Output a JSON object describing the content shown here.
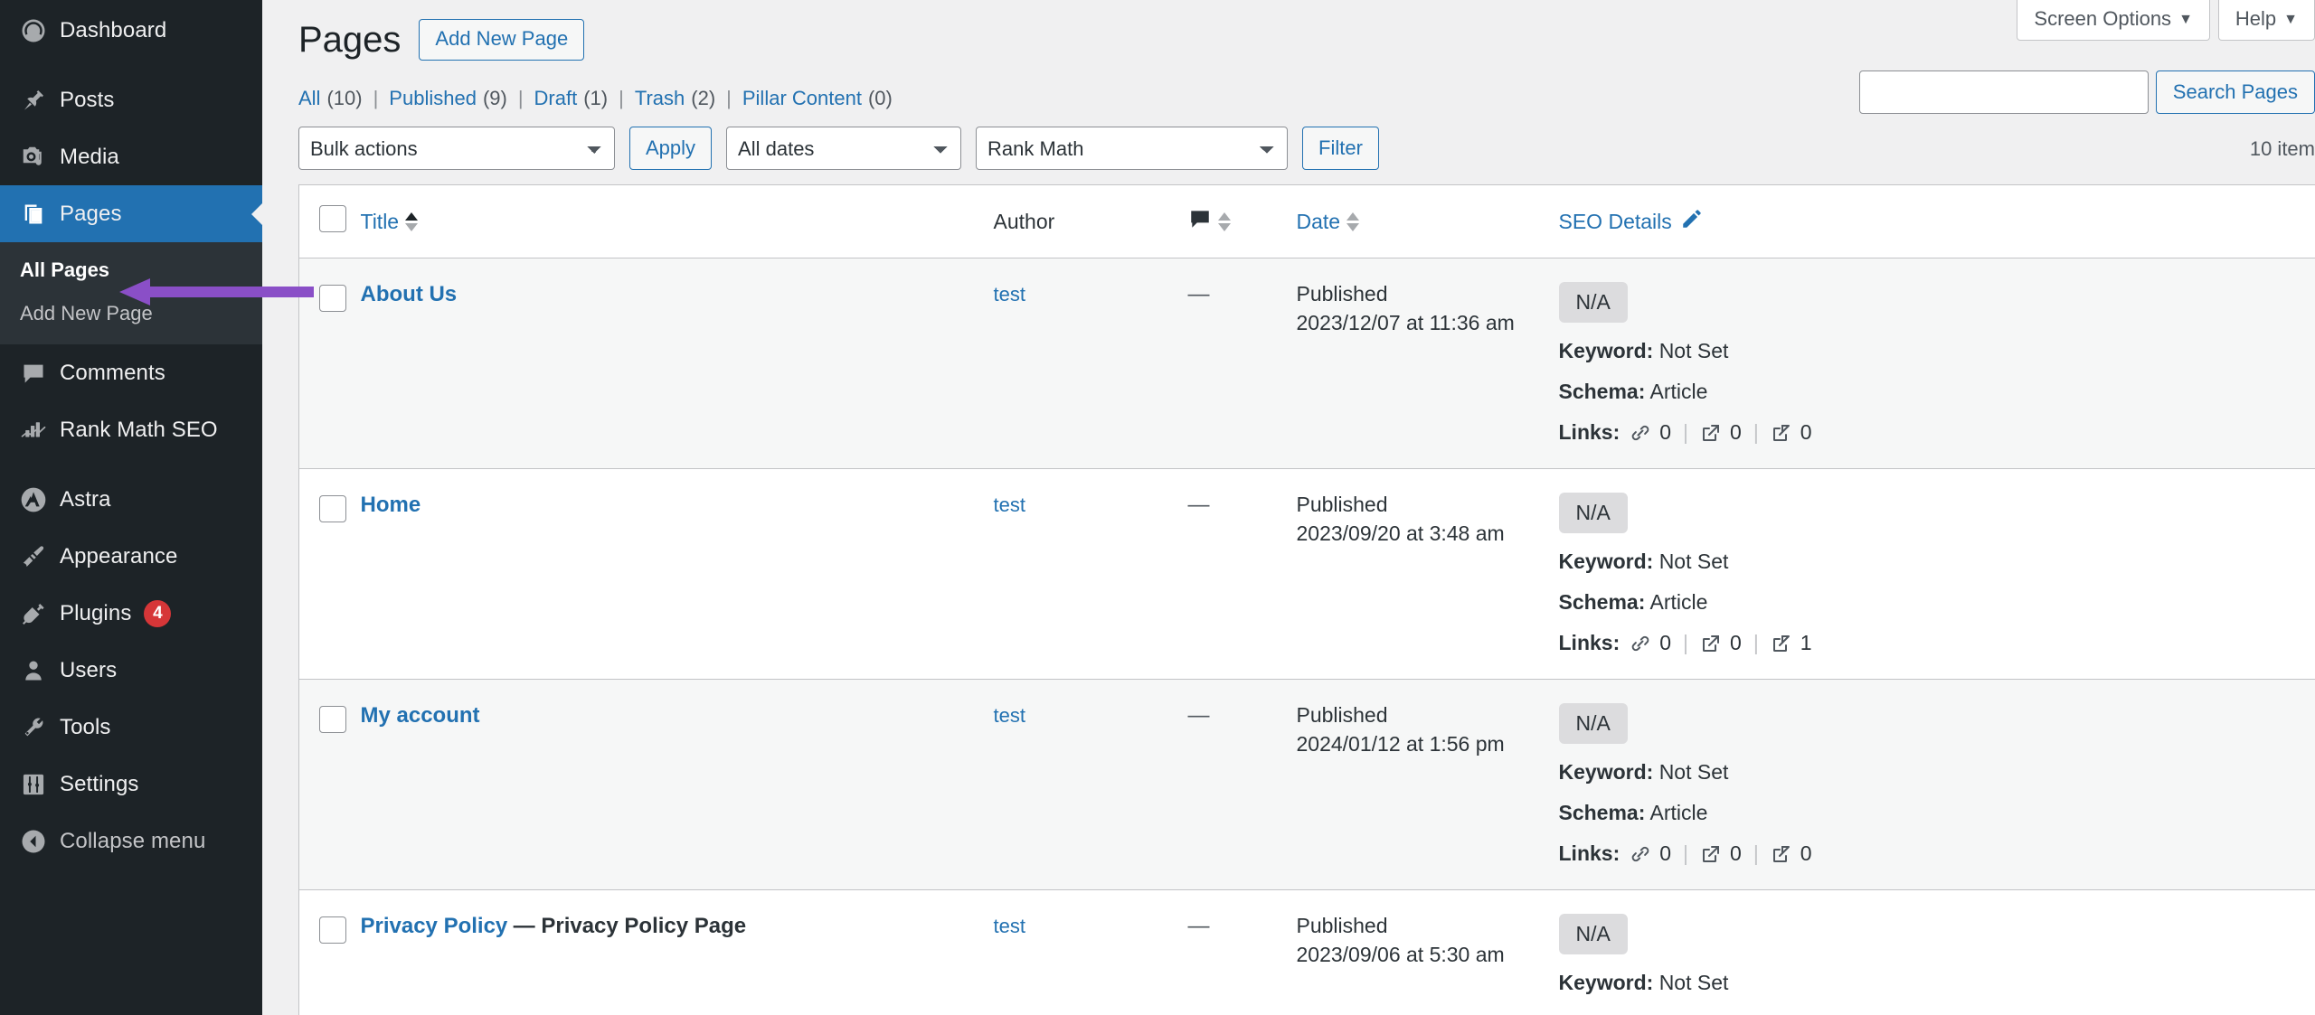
{
  "sidebar": {
    "items": [
      {
        "label": "Dashboard",
        "icon": "dashboard-icon",
        "name": "sidebar-item-dashboard"
      },
      {
        "label": "Posts",
        "icon": "pin-icon",
        "name": "sidebar-item-posts"
      },
      {
        "label": "Media",
        "icon": "media-icon",
        "name": "sidebar-item-media"
      },
      {
        "label": "Pages",
        "icon": "pages-icon",
        "name": "sidebar-item-pages"
      },
      {
        "label": "Comments",
        "icon": "comment-icon",
        "name": "sidebar-item-comments"
      },
      {
        "label": "Rank Math SEO",
        "icon": "rankmath-icon",
        "name": "sidebar-item-rank-math-seo"
      },
      {
        "label": "Astra",
        "icon": "astra-icon",
        "name": "sidebar-item-astra"
      },
      {
        "label": "Appearance",
        "icon": "paintbrush-icon",
        "name": "sidebar-item-appearance"
      },
      {
        "label": "Plugins",
        "icon": "plug-icon",
        "name": "sidebar-item-plugins",
        "badge": "4"
      },
      {
        "label": "Users",
        "icon": "user-icon",
        "name": "sidebar-item-users"
      },
      {
        "label": "Tools",
        "icon": "wrench-icon",
        "name": "sidebar-item-tools"
      },
      {
        "label": "Settings",
        "icon": "sliders-icon",
        "name": "sidebar-item-settings"
      },
      {
        "label": "Collapse menu",
        "icon": "collapse-arrow-icon",
        "name": "sidebar-item-collapse-menu"
      }
    ],
    "submenu": {
      "all_pages": "All Pages",
      "add_new_page": "Add New Page"
    },
    "current_item": "Pages",
    "current_submenu": "All Pages",
    "accent_color": "#2271b1",
    "badge_color": "#d63638"
  },
  "screen_meta": {
    "screen_options": "Screen Options",
    "help": "Help",
    "caret": "▼"
  },
  "header": {
    "title": "Pages",
    "add_new_label": "Add New Page"
  },
  "status_links": [
    {
      "label": "All",
      "count": "(10)",
      "current": true
    },
    {
      "label": "Published",
      "count": "(9)",
      "current": false
    },
    {
      "label": "Draft",
      "count": "(1)",
      "current": false
    },
    {
      "label": "Trash",
      "count": "(2)",
      "current": false
    },
    {
      "label": "Pillar Content",
      "count": "(0)",
      "current": false
    }
  ],
  "status_divider": "|",
  "search": {
    "value": "",
    "placeholder": "",
    "submit_label": "Search Pages"
  },
  "tablenav": {
    "bulk_actions_selected": "Bulk actions",
    "apply_label": "Apply",
    "dates_selected": "All dates",
    "rankmath_selected": "Rank Math",
    "filter_label": "Filter",
    "displaying_num": "10 item"
  },
  "table": {
    "columns": {
      "title": "Title",
      "author": "Author",
      "comments": "",
      "date": "Date",
      "seo_details": "SEO Details"
    },
    "rows": [
      {
        "title": "About Us",
        "state": "",
        "author": "test",
        "comments": "—",
        "date_status": "Published",
        "date_value": "2023/12/07 at 11:36 am",
        "seo_score": "N/A",
        "keyword_label": "Keyword:",
        "keyword_value": "Not Set",
        "schema_label": "Schema:",
        "schema_value": "Article",
        "links_label": "Links:",
        "internal_links": "0",
        "external_links": "0",
        "incoming_links": "0"
      },
      {
        "title": "Home",
        "state": "",
        "author": "test",
        "comments": "—",
        "date_status": "Published",
        "date_value": "2023/09/20 at 3:48 am",
        "seo_score": "N/A",
        "keyword_label": "Keyword:",
        "keyword_value": "Not Set",
        "schema_label": "Schema:",
        "schema_value": "Article",
        "links_label": "Links:",
        "internal_links": "0",
        "external_links": "0",
        "incoming_links": "1"
      },
      {
        "title": "My account",
        "state": "",
        "author": "test",
        "comments": "—",
        "date_status": "Published",
        "date_value": "2024/01/12 at 1:56 pm",
        "seo_score": "N/A",
        "keyword_label": "Keyword:",
        "keyword_value": "Not Set",
        "schema_label": "Schema:",
        "schema_value": "Article",
        "links_label": "Links:",
        "internal_links": "0",
        "external_links": "0",
        "incoming_links": "0"
      },
      {
        "title": "Privacy Policy",
        "state": "— Privacy Policy Page",
        "author": "test",
        "comments": "—",
        "date_status": "Published",
        "date_value": "2023/09/06 at 5:30 am",
        "seo_score": "N/A",
        "keyword_label": "Keyword:",
        "keyword_value": "Not Set",
        "schema_label": "",
        "schema_value": "",
        "links_label": "",
        "internal_links": "",
        "external_links": "",
        "incoming_links": ""
      }
    ]
  },
  "annotation": {
    "arrow_color": "#8a4fc7",
    "points_to": "All Pages"
  }
}
